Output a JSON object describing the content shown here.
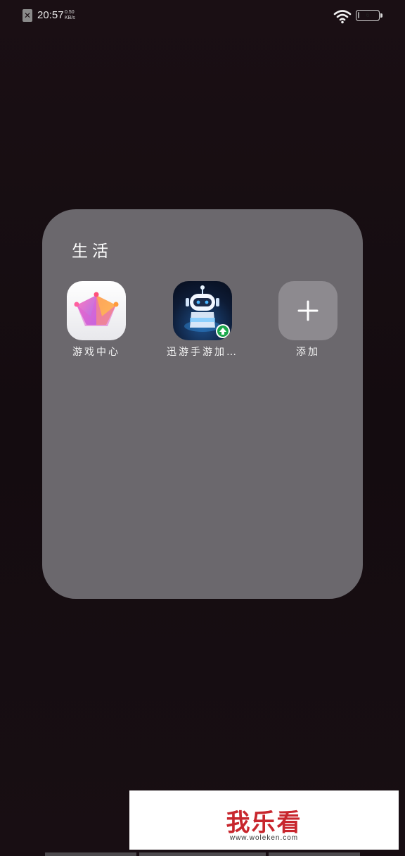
{
  "status_bar": {
    "sim_icon": "sim-card-disabled-icon",
    "time": "20:57",
    "speed_value": "0.50",
    "speed_unit": "KB/s",
    "wifi_icon": "wifi-icon",
    "battery_icon": "battery-icon",
    "battery_level": "6",
    "battery_fraction": 0.06
  },
  "folder": {
    "title": "生活",
    "background": "#6b686d",
    "apps": [
      {
        "label": "游戏中心",
        "icon": "game-center-crown-icon"
      },
      {
        "label": "迅游手游加…",
        "icon": "xunyou-robot-icon"
      },
      {
        "label": "添加",
        "icon": "plus-icon"
      }
    ]
  },
  "watermark": {
    "title": "我乐看",
    "url": "www.woleken.com",
    "color": "#c8262d"
  }
}
